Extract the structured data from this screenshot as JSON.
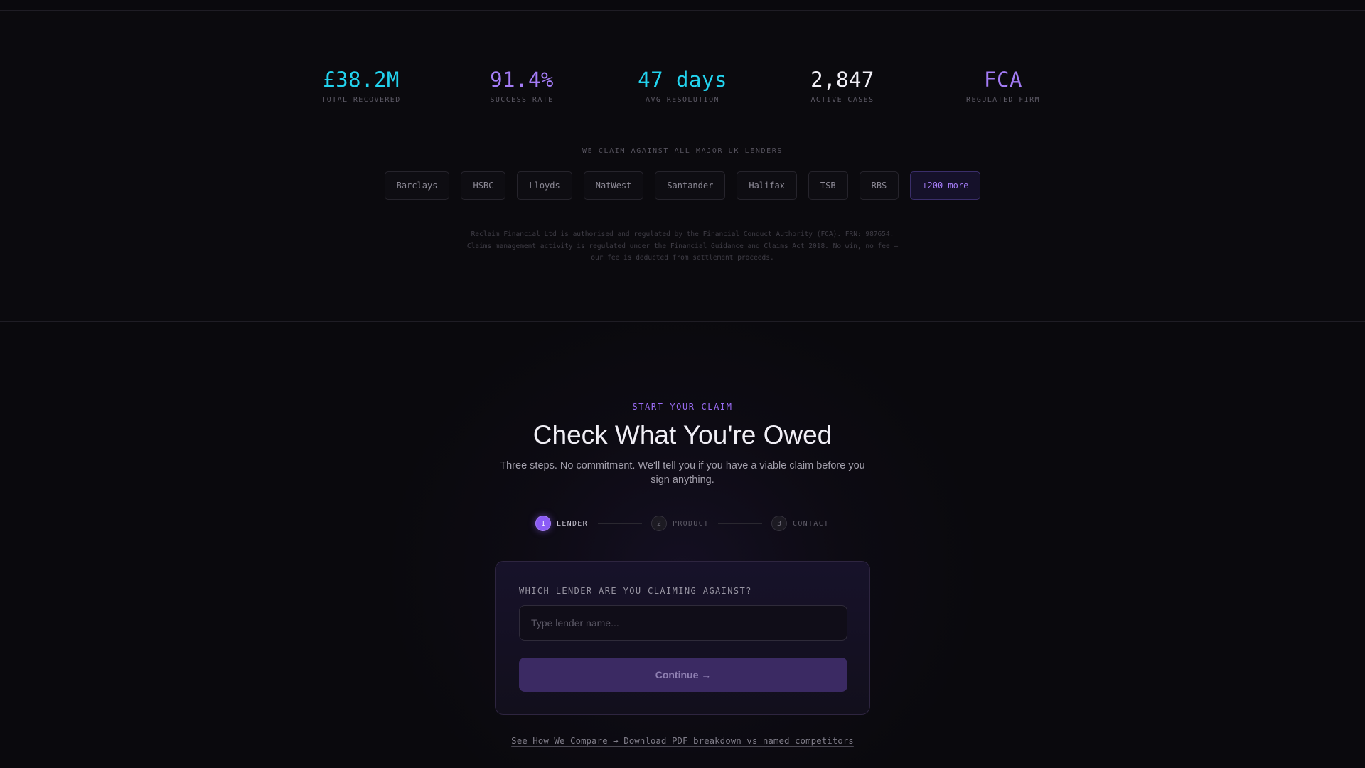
{
  "stats": [
    {
      "value": "£38.2M",
      "label": "TOTAL RECOVERED",
      "color": "#22d3ee"
    },
    {
      "value": "91.4%",
      "label": "SUCCESS RATE",
      "color": "#a47cf6"
    },
    {
      "value": "47 days",
      "label": "AVG RESOLUTION",
      "color": "#22d3ee"
    },
    {
      "value": "2,847",
      "label": "ACTIVE CASES",
      "color": "#f1eff6"
    },
    {
      "value": "FCA",
      "label": "REGULATED FIRM",
      "color": "#a47cf6"
    }
  ],
  "lenders": {
    "heading": "WE CLAIM AGAINST ALL MAJOR UK LENDERS",
    "chips": [
      "Barclays",
      "HSBC",
      "Lloyds",
      "NatWest",
      "Santander",
      "Halifax",
      "TSB",
      "RBS"
    ],
    "more": "+200 more"
  },
  "disclaimer": {
    "line1": "Reclaim Financial Ltd is authorised and regulated by the Financial Conduct Authority (FCA). FRN: 987654.",
    "line2": "Claims management activity is regulated under the Financial Guidance and Claims Act 2018. No win, no fee —",
    "line3": "our fee is deducted from settlement proceeds."
  },
  "claim": {
    "eyebrow": "START YOUR CLAIM",
    "title": "Check What You're Owed",
    "subtitle": "Three steps. No commitment. We'll tell you if you have a viable claim before you sign anything.",
    "steps": [
      {
        "num": "1",
        "label": "LENDER"
      },
      {
        "num": "2",
        "label": "PRODUCT"
      },
      {
        "num": "3",
        "label": "CONTACT"
      }
    ],
    "question": "WHICH LENDER ARE YOU CLAIMING AGAINST?",
    "input_placeholder": "Type lender name...",
    "input_value": "",
    "continue_label": "Continue →",
    "compare_link": "See How We Compare → Download PDF breakdown vs named competitors"
  },
  "colors": {
    "accent": "#8b5cf6",
    "cyan": "#22d3ee",
    "background": "#0a090d"
  }
}
